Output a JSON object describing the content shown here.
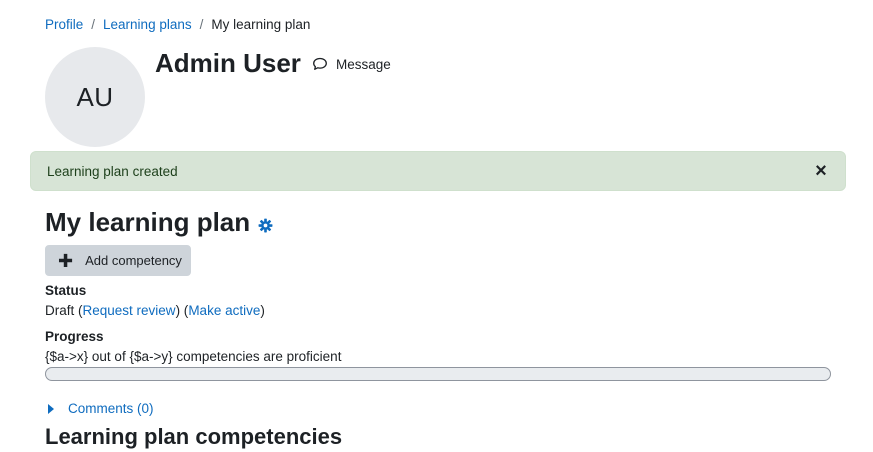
{
  "breadcrumb": {
    "items": [
      {
        "label": "Profile"
      },
      {
        "label": "Learning plans"
      }
    ],
    "separator": "/",
    "current": "My learning plan"
  },
  "user": {
    "initials": "AU",
    "name": "Admin User",
    "message_label": "Message",
    "message_icon": "speech-bubble-icon"
  },
  "alert": {
    "text": "Learning plan created",
    "close_label": "×",
    "close_icon": "close-icon",
    "color": "#d7e4d6"
  },
  "plan": {
    "title": "My learning plan",
    "settings_icon": "gear-icon",
    "add_label": "Add competency",
    "add_icon": "plus-icon"
  },
  "status": {
    "heading": "Status",
    "value": "Draft",
    "review_link": "Request review",
    "active_link": "Make active"
  },
  "progress": {
    "heading": "Progress",
    "text": "{$a->x} out of {$a->y} competencies are proficient",
    "fraction": 0
  },
  "comments": {
    "label": "Comments (0)",
    "icon": "caret-right-icon"
  },
  "section": {
    "heading": "Learning plan competencies"
  },
  "colors": {
    "link": "#0f6cbf",
    "button_bg": "#ced4da",
    "avatar_bg": "#e7e9ec"
  }
}
